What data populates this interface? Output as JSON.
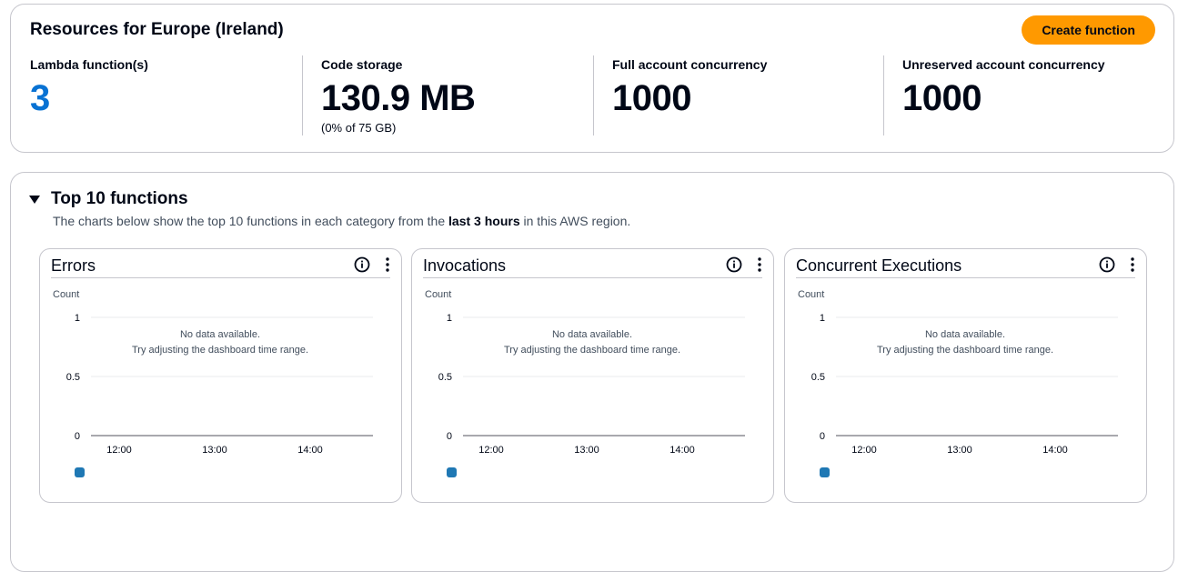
{
  "resources": {
    "title": "Resources for Europe (Ireland)",
    "create_label": "Create function",
    "stats": [
      {
        "label": "Lambda function(s)",
        "value": "3",
        "sub": ""
      },
      {
        "label": "Code storage",
        "value": "130.9 MB",
        "sub": "(0% of 75 GB)"
      },
      {
        "label": "Full account concurrency",
        "value": "1000",
        "sub": ""
      },
      {
        "label": "Unreserved account concurrency",
        "value": "1000",
        "sub": ""
      }
    ]
  },
  "top10": {
    "title": "Top 10 functions",
    "desc_before": "The charts below show the top 10 functions in each category from the ",
    "desc_bold": "last 3 hours",
    "desc_after": " in this AWS region."
  },
  "colors": {
    "accent": "#ff9900",
    "link": "#0972d3",
    "series": "#1f78b4"
  },
  "chart_data": [
    {
      "type": "line",
      "title": "Errors",
      "ylabel": "Count",
      "yticks": [
        "1",
        "0.5",
        "0"
      ],
      "ylim": [
        0,
        1
      ],
      "xticks": [
        "12:00",
        "13:00",
        "14:00"
      ],
      "series": [],
      "empty_line1": "No data available.",
      "empty_line2": "Try adjusting the dashboard time range."
    },
    {
      "type": "line",
      "title": "Invocations",
      "ylabel": "Count",
      "yticks": [
        "1",
        "0.5",
        "0"
      ],
      "ylim": [
        0,
        1
      ],
      "xticks": [
        "12:00",
        "13:00",
        "14:00"
      ],
      "series": [],
      "empty_line1": "No data available.",
      "empty_line2": "Try adjusting the dashboard time range."
    },
    {
      "type": "line",
      "title": "Concurrent Executions",
      "ylabel": "Count",
      "yticks": [
        "1",
        "0.5",
        "0"
      ],
      "ylim": [
        0,
        1
      ],
      "xticks": [
        "12:00",
        "13:00",
        "14:00"
      ],
      "series": [],
      "empty_line1": "No data available.",
      "empty_line2": "Try adjusting the dashboard time range."
    }
  ]
}
